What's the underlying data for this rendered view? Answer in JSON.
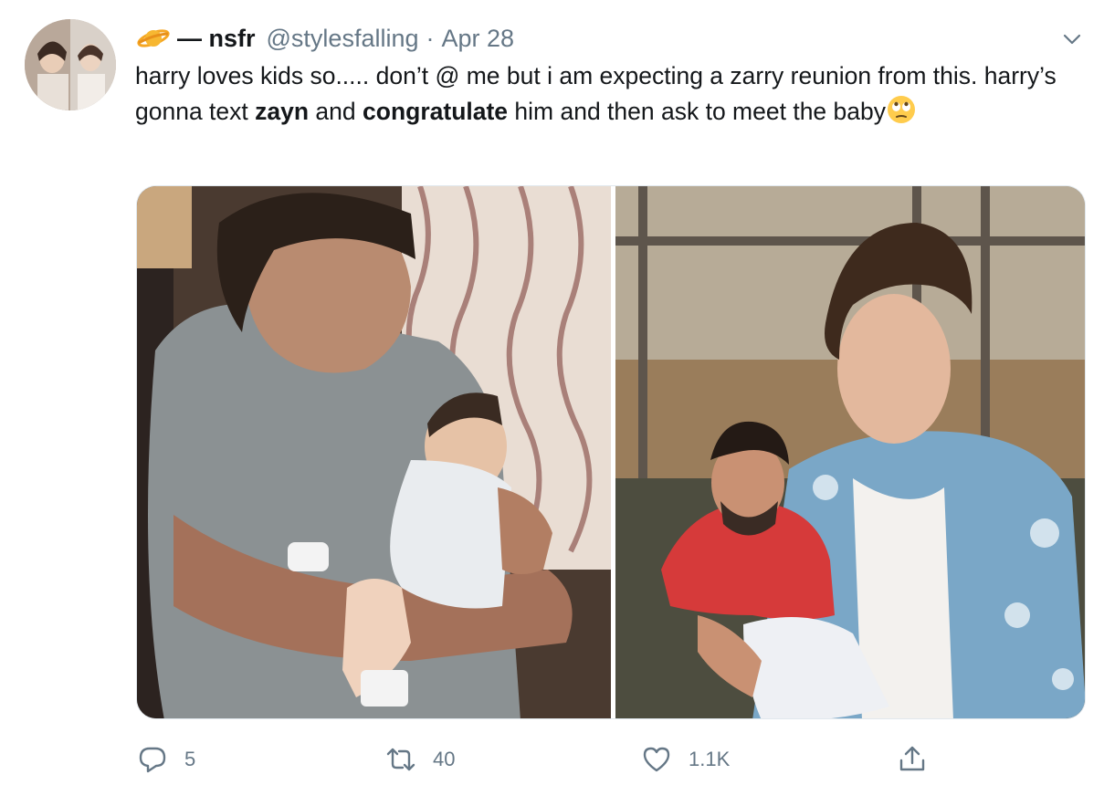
{
  "tweet": {
    "display_name": "— nsfr",
    "handle": "@stylesfalling",
    "separator": "·",
    "date": "Apr 28",
    "text": {
      "part1": "harry loves kids so..... don’t @ me but i am expecting a zarry reunion from this. harry’s gonna text ",
      "bold1": "zayn",
      "part2": " and ",
      "bold2": "congratulate",
      "part3": " him and then ask to meet the baby"
    },
    "emoji": "face-with-rolling-eyes-icon"
  },
  "actions": {
    "replies": "5",
    "retweets": "40",
    "likes": "1.1K"
  },
  "colors": {
    "text": "#14171a",
    "muted": "#657786",
    "border": "#e1e8ed"
  },
  "icons": {
    "name_emoji": "ringed-planet-icon",
    "menu": "chevron-down-icon",
    "reply": "comment-icon",
    "retweet": "retweet-icon",
    "like": "heart-icon",
    "share": "share-icon"
  }
}
